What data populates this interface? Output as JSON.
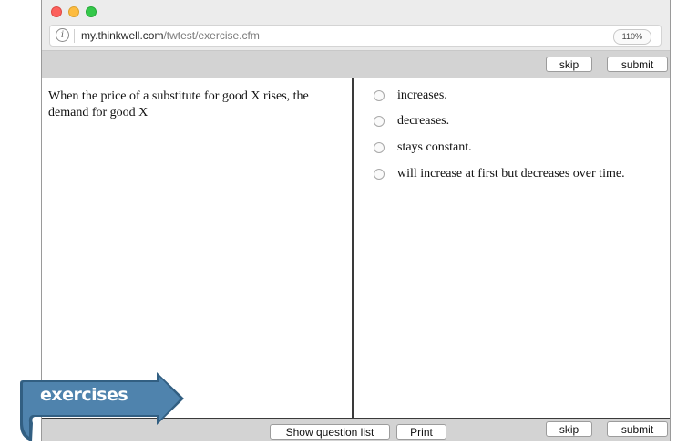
{
  "browser": {
    "url_host": "my.thinkwell.com",
    "url_path": "/twtest/exercise.cfm",
    "zoom": "110%"
  },
  "toolbar": {
    "skip_label": "skip",
    "submit_label": "submit"
  },
  "question": {
    "text": "When the price of a substitute for good X rises, the demand for good X"
  },
  "answers": [
    {
      "label": "increases."
    },
    {
      "label": "decreases."
    },
    {
      "label": "stays constant."
    },
    {
      "label": "will increase at first but decreases over time."
    }
  ],
  "bottom_bar": {
    "show_list_label": "Show question list",
    "print_label": "Print",
    "skip_label": "skip",
    "submit_label": "submit"
  },
  "banner": {
    "label": "exercises"
  },
  "colors": {
    "banner_blue": "#4f83ad",
    "banner_dark": "#325f82",
    "toolbar_gray": "#d3d3d3"
  }
}
